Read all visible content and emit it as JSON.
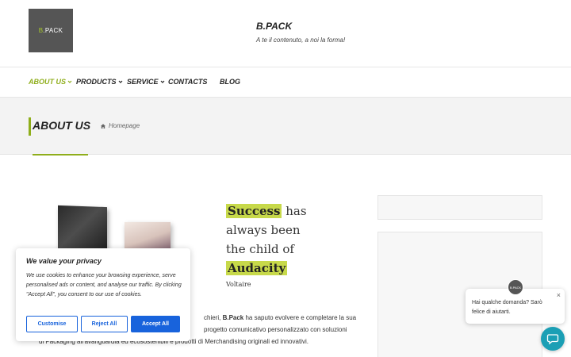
{
  "header": {
    "logo_text": "B.PACK",
    "logo_prefix": "B",
    "logo_suffix": ".PACK",
    "site_title": "B.PACK",
    "tagline": "A te il contenuto, a noi la forma!"
  },
  "nav": {
    "items": [
      {
        "label": "ABOUT US",
        "active": true,
        "has_dropdown": true
      },
      {
        "label": "PRODUCTS",
        "active": false,
        "has_dropdown": true
      },
      {
        "label": "SERVICE",
        "active": false,
        "has_dropdown": true
      },
      {
        "label": "CONTACTS",
        "active": false,
        "has_dropdown": false
      },
      {
        "label": "BLOG",
        "active": false,
        "has_dropdown": false
      }
    ]
  },
  "banner": {
    "title": "ABOUT US",
    "breadcrumb": "Homepage",
    "breadcrumb_icon": "home-icon"
  },
  "quote": {
    "word1": "Success",
    "rest1": " has",
    "line2": "always been",
    "line3": "the child of",
    "word4": "Audacity",
    "author": "Voltaire"
  },
  "body": {
    "line1_pre": "chieri, ",
    "brand": "B.Pack",
    "line1_post": " ha saputo evolvere e completare la sua",
    "line2": "progetto comunicativo personalizzato con soluzioni",
    "line3": "di Packaging all'avanguardia ed ecosostenibili e prodotti di Merchandising originali ed innovativi."
  },
  "cookie": {
    "title": "We value your privacy",
    "text": "We use cookies to enhance your browsing experience, serve personalised ads or content, and analyse our traffic. By clicking \"Accept All\", you consent to our use of cookies.",
    "customise": "Customise",
    "reject": "Reject All",
    "accept": "Accept All"
  },
  "chat": {
    "message": "Hai qualche domanda? Sarò felice di aiutarti.",
    "close": "×"
  },
  "colors": {
    "accent": "#8fae1b",
    "highlight": "#c7d94a",
    "cookie_blue": "#1863dc",
    "chat_teal": "#1b9fb5"
  }
}
